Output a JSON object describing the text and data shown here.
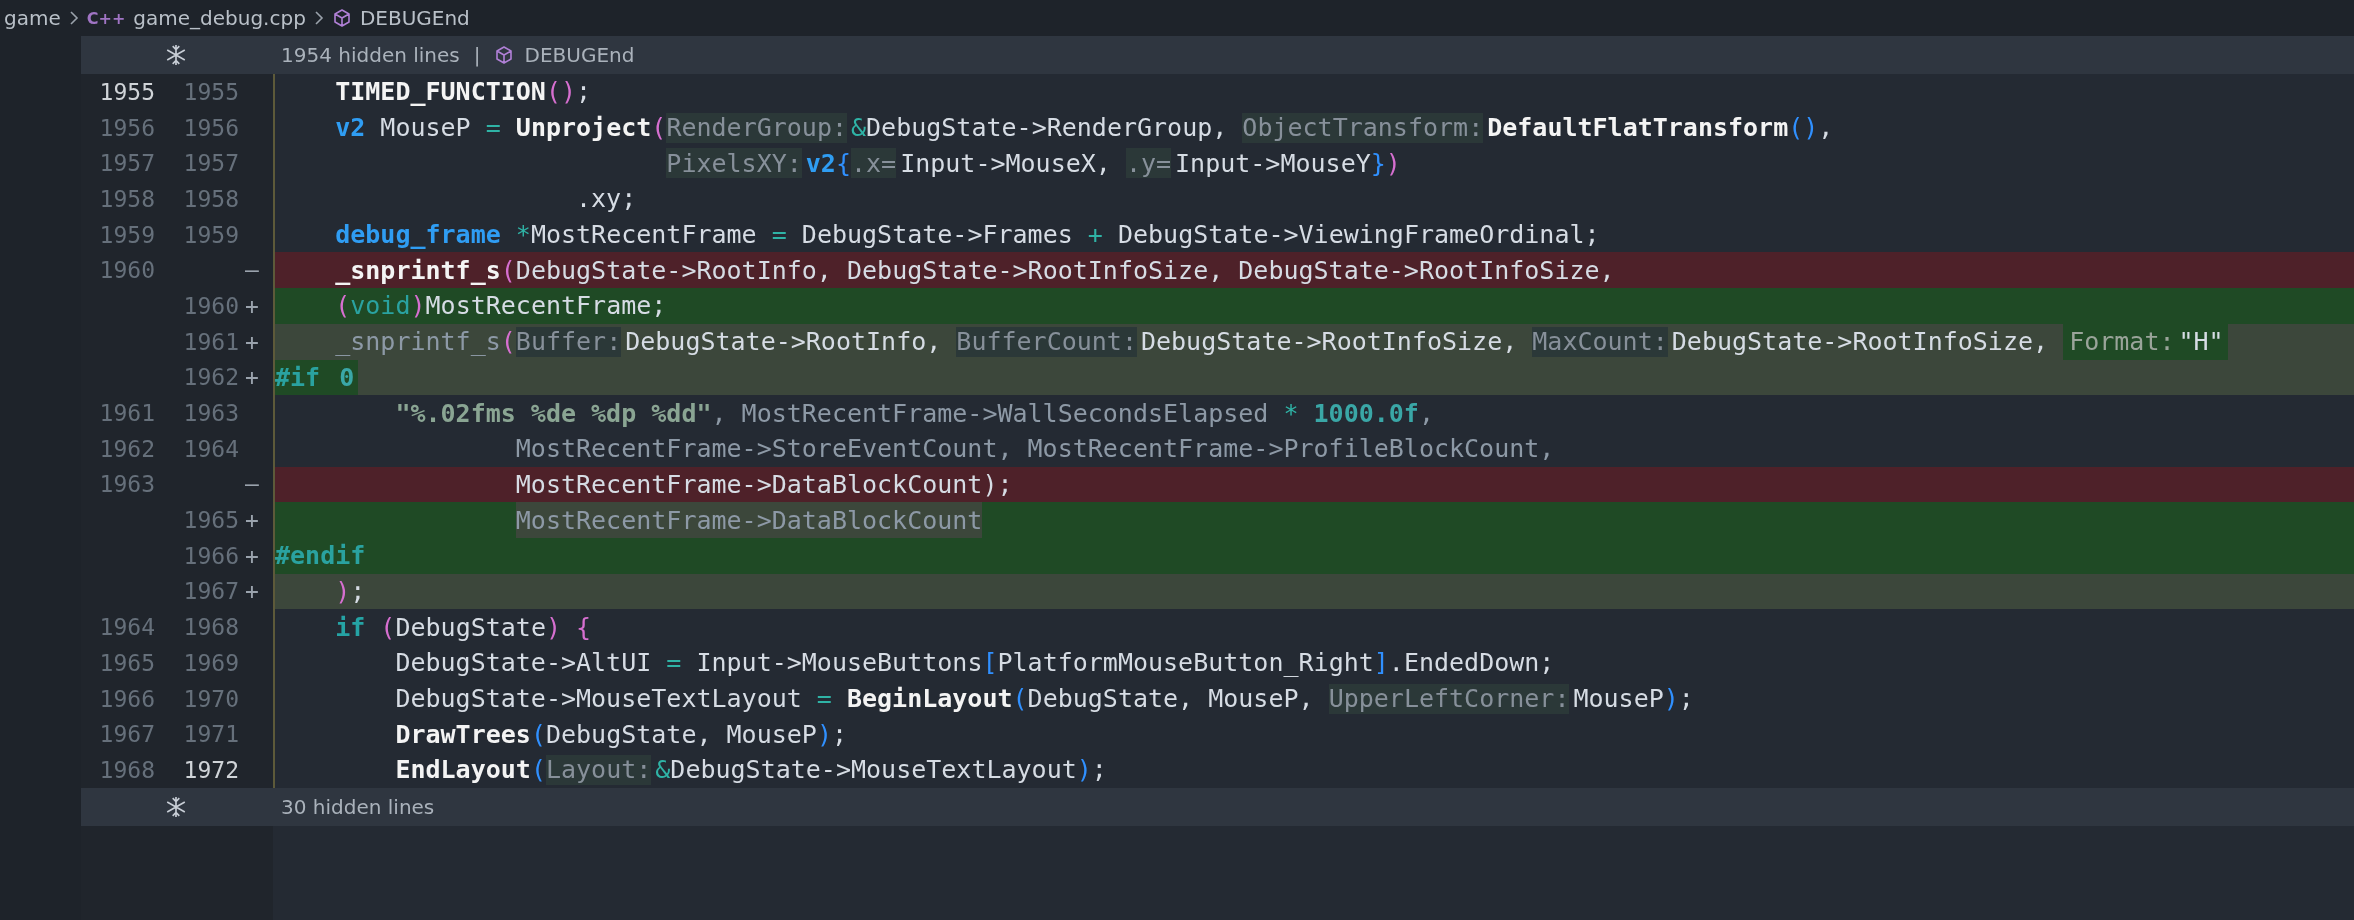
{
  "breadcrumb": {
    "folder": "game",
    "file_icon": "C++",
    "file": "game_debug.cpp",
    "symbol": "DEBUGEnd"
  },
  "fold_top": {
    "text": "1954 hidden lines",
    "separator": "|",
    "symbol": "DEBUGEnd"
  },
  "lines": [
    {
      "old": "1955",
      "new": "1955",
      "kind": "context",
      "old_active": true,
      "tokens": [
        {
          "kind": "indent-one"
        },
        {
          "t": "TIMED_FUNCTION",
          "kind": "fn"
        },
        {
          "t": "()",
          "kind": "b1"
        },
        {
          "t": ";",
          "kind": "p"
        }
      ]
    },
    {
      "old": "1956",
      "new": "1956",
      "kind": "context",
      "tokens": [
        {
          "kind": "indent-one"
        },
        {
          "t": "v2",
          "kind": "kw"
        },
        {
          "t": " MouseP ",
          "kind": "p"
        },
        {
          "t": "=",
          "kind": "op"
        },
        {
          "t": " Unproject",
          "kind": "fn"
        },
        {
          "t": "(",
          "kind": "b1"
        },
        {
          "t": "RenderGroup:",
          "kind": "hint"
        },
        {
          "t": "&",
          "kind": "op"
        },
        {
          "t": "DebugState->RenderGroup, ",
          "kind": "p"
        },
        {
          "t": "ObjectTransform:",
          "kind": "hint"
        },
        {
          "t": "DefaultFlatTransform",
          "kind": "fn"
        },
        {
          "t": "()",
          "kind": "b2"
        },
        {
          "t": ",",
          "kind": "p"
        }
      ]
    },
    {
      "old": "1957",
      "new": "1957",
      "kind": "context",
      "tokens": [
        {
          "kind": "indent-hint"
        },
        {
          "t": "PixelsXY:",
          "kind": "hint"
        },
        {
          "t": "v2",
          "kind": "kw"
        },
        {
          "t": "{",
          "kind": "b2"
        },
        {
          "t": ".x=",
          "kind": "hint"
        },
        {
          "t": "Input->MouseX, ",
          "kind": "p"
        },
        {
          "t": ".y=",
          "kind": "hint"
        },
        {
          "t": "Input->MouseY",
          "kind": "p"
        },
        {
          "t": "}",
          "kind": "b2"
        },
        {
          "t": ")",
          "kind": "b1"
        }
      ]
    },
    {
      "old": "1958",
      "new": "1958",
      "kind": "context",
      "tokens": [
        {
          "kind": "indent-five"
        },
        {
          "t": ".xy;",
          "kind": "p"
        }
      ]
    },
    {
      "old": "1959",
      "new": "1959",
      "kind": "context",
      "tokens": [
        {
          "kind": "indent-one"
        },
        {
          "t": "debug_frame",
          "kind": "kw"
        },
        {
          "t": " *",
          "kind": "op"
        },
        {
          "t": "MostRecentFrame ",
          "kind": "p"
        },
        {
          "t": "=",
          "kind": "op"
        },
        {
          "t": " DebugState->Frames ",
          "kind": "p"
        },
        {
          "t": "+",
          "kind": "op"
        },
        {
          "t": " DebugState->ViewingFrameOrdinal;",
          "kind": "p"
        }
      ]
    },
    {
      "old": "1960",
      "marker": "—",
      "kind": "removed",
      "tokens": [
        {
          "kind": "indent-one"
        },
        {
          "t": "_snprintf_s",
          "kind": "fn"
        },
        {
          "t": "(",
          "kind": "b1"
        },
        {
          "t": "DebugState->RootInfo, DebugState->RootInfoSize, DebugState->RootInfoSize,",
          "kind": "p"
        }
      ]
    },
    {
      "new": "1960",
      "marker": "+",
      "kind": "added",
      "tokens": [
        {
          "kind": "indent-one"
        },
        {
          "t": "(",
          "kind": "b1"
        },
        {
          "t": "void",
          "kind": "ty"
        },
        {
          "t": ")",
          "kind": "b1"
        },
        {
          "t": "MostRecentFrame;",
          "kind": "p"
        }
      ]
    },
    {
      "new": "1961",
      "marker": "+",
      "kind": "added-soft",
      "tokens": [
        {
          "kind": "indent-one"
        },
        {
          "t": "_snprintf_s",
          "kind": "dim"
        },
        {
          "t": "(",
          "kind": "b1"
        },
        {
          "t": "Buffer:",
          "kind": "hint"
        },
        {
          "t": "DebugState->RootInfo, ",
          "kind": "p"
        },
        {
          "t": "BufferCount:",
          "kind": "hint"
        },
        {
          "t": "DebugState->RootInfoSize, ",
          "kind": "p"
        },
        {
          "t": "MaxCount:",
          "kind": "hint"
        },
        {
          "t": "DebugState->RootInfoSize, ",
          "kind": "p"
        },
        {
          "t": "Format:",
          "kind": "hint",
          "mark": true
        },
        {
          "t": "\"H\"",
          "kind": "p",
          "mark": true
        }
      ]
    },
    {
      "new": "1962",
      "marker": "+",
      "kind": "added-soft",
      "tokens": [
        {
          "t": "#if",
          "kind": "pre",
          "mark": true
        },
        {
          "t": " 0",
          "kind": "num",
          "mark": true
        }
      ]
    },
    {
      "old": "1961",
      "new": "1963",
      "kind": "context",
      "tokens": [
        {
          "kind": "indent-two"
        },
        {
          "t": "\"%.02fms %de %dp %dd\"",
          "kind": "str"
        },
        {
          "t": ", MostRecentFrame->WallSecondsElapsed ",
          "kind": "dim"
        },
        {
          "t": "*",
          "kind": "op"
        },
        {
          "t": " 1000.0f",
          "kind": "num"
        },
        {
          "t": ",",
          "kind": "dim"
        }
      ]
    },
    {
      "old": "1962",
      "new": "1964",
      "kind": "context",
      "tokens": [
        {
          "kind": "indent-four"
        },
        {
          "t": "MostRecentFrame->StoreEventCount, MostRecentFrame->ProfileBlockCount,",
          "kind": "dim"
        }
      ]
    },
    {
      "old": "1963",
      "marker": "—",
      "kind": "removed",
      "tokens": [
        {
          "kind": "indent-four"
        },
        {
          "t": "MostRecentFrame->DataBlockCount);",
          "kind": "p"
        }
      ]
    },
    {
      "new": "1965",
      "marker": "+",
      "kind": "added",
      "tokens": [
        {
          "kind": "indent-four"
        },
        {
          "t": "MostRecentFrame->DataBlockCount",
          "kind": "dim",
          "mark": true
        }
      ]
    },
    {
      "new": "1966",
      "marker": "+",
      "kind": "added",
      "tokens": [
        {
          "t": "#endif",
          "kind": "pre"
        }
      ]
    },
    {
      "new": "1967",
      "marker": "+",
      "kind": "added-soft",
      "tokens": [
        {
          "kind": "indent-one"
        },
        {
          "t": ")",
          "kind": "b1"
        },
        {
          "t": ";",
          "kind": "p"
        }
      ]
    },
    {
      "old": "1964",
      "new": "1968",
      "kind": "context",
      "tokens": [
        {
          "kind": "indent-one"
        },
        {
          "t": "if",
          "kind": "kwt"
        },
        {
          "t": " (",
          "kind": "b1"
        },
        {
          "t": "DebugState",
          "kind": "p"
        },
        {
          "t": ") {",
          "kind": "b1"
        }
      ]
    },
    {
      "old": "1965",
      "new": "1969",
      "kind": "context",
      "tokens": [
        {
          "kind": "indent-two"
        },
        {
          "t": "DebugState->AltUI ",
          "kind": "p"
        },
        {
          "t": "=",
          "kind": "op"
        },
        {
          "t": " Input->MouseButtons",
          "kind": "p"
        },
        {
          "t": "[",
          "kind": "b2"
        },
        {
          "t": "PlatformMouseButton_Right",
          "kind": "p"
        },
        {
          "t": "]",
          "kind": "b2"
        },
        {
          "t": ".EndedDown;",
          "kind": "p"
        }
      ]
    },
    {
      "old": "1966",
      "new": "1970",
      "kind": "context",
      "tokens": [
        {
          "kind": "indent-two"
        },
        {
          "t": "DebugState->MouseTextLayout ",
          "kind": "p"
        },
        {
          "t": "=",
          "kind": "op"
        },
        {
          "t": " BeginLayout",
          "kind": "fn"
        },
        {
          "t": "(",
          "kind": "b2"
        },
        {
          "t": "DebugState, MouseP, ",
          "kind": "p"
        },
        {
          "t": "UpperLeftCorner:",
          "kind": "hint"
        },
        {
          "t": "MouseP",
          "kind": "p"
        },
        {
          "t": ")",
          "kind": "b2"
        },
        {
          "t": ";",
          "kind": "p"
        }
      ]
    },
    {
      "old": "1967",
      "new": "1971",
      "kind": "context",
      "tokens": [
        {
          "kind": "indent-two"
        },
        {
          "t": "DrawTrees",
          "kind": "fn"
        },
        {
          "t": "(",
          "kind": "b2"
        },
        {
          "t": "DebugState, MouseP",
          "kind": "p"
        },
        {
          "t": ")",
          "kind": "b2"
        },
        {
          "t": ";",
          "kind": "p"
        }
      ]
    },
    {
      "old": "1968",
      "new": "1972",
      "kind": "context",
      "new_active": true,
      "tokens": [
        {
          "kind": "indent-two"
        },
        {
          "t": "EndLayout",
          "kind": "fn"
        },
        {
          "t": "(",
          "kind": "b2"
        },
        {
          "t": "Layout:",
          "kind": "hint"
        },
        {
          "t": "&",
          "kind": "op"
        },
        {
          "t": "DebugState->MouseTextLayout",
          "kind": "p"
        },
        {
          "t": ")",
          "kind": "b2"
        },
        {
          "t": ";",
          "kind": "p"
        }
      ]
    }
  ],
  "fold_bottom": {
    "text": "30 hidden lines"
  }
}
